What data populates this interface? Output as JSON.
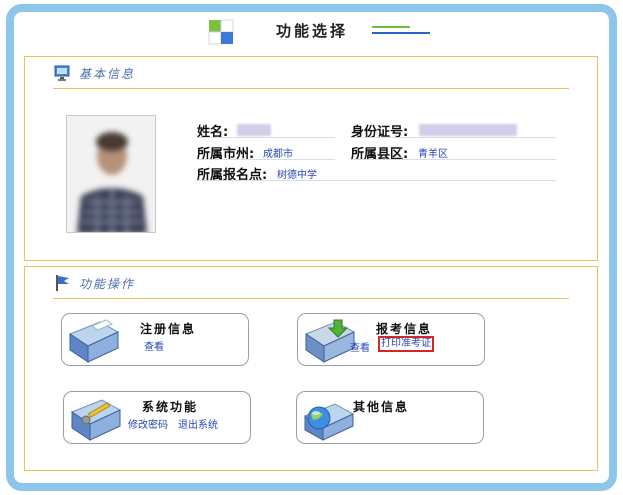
{
  "header": {
    "title": "功能选择"
  },
  "basic_info": {
    "section_title": "基本信息",
    "fields": {
      "name_label": "姓名:",
      "id_label": "身份证号:",
      "city_label": "所属市州:",
      "city_value": "成都市",
      "county_label": "所属县区:",
      "county_value": "青羊区",
      "site_label": "所属报名点:",
      "site_value": "树德中学"
    }
  },
  "functions": {
    "section_title": "功能操作",
    "cards": {
      "register": {
        "title": "注册信息",
        "links": [
          "查看"
        ]
      },
      "exam": {
        "title": "报考信息",
        "links": [
          "查看",
          "打印准考证"
        ]
      },
      "system": {
        "title": "系统功能",
        "links": [
          "修改密码",
          "退出系统"
        ]
      },
      "other": {
        "title": "其他信息",
        "links": []
      }
    }
  },
  "colors": {
    "frame": "#8ec5ea",
    "panel_border": "#f0c060",
    "link": "#2747b5",
    "highlight": "#d3262b"
  }
}
